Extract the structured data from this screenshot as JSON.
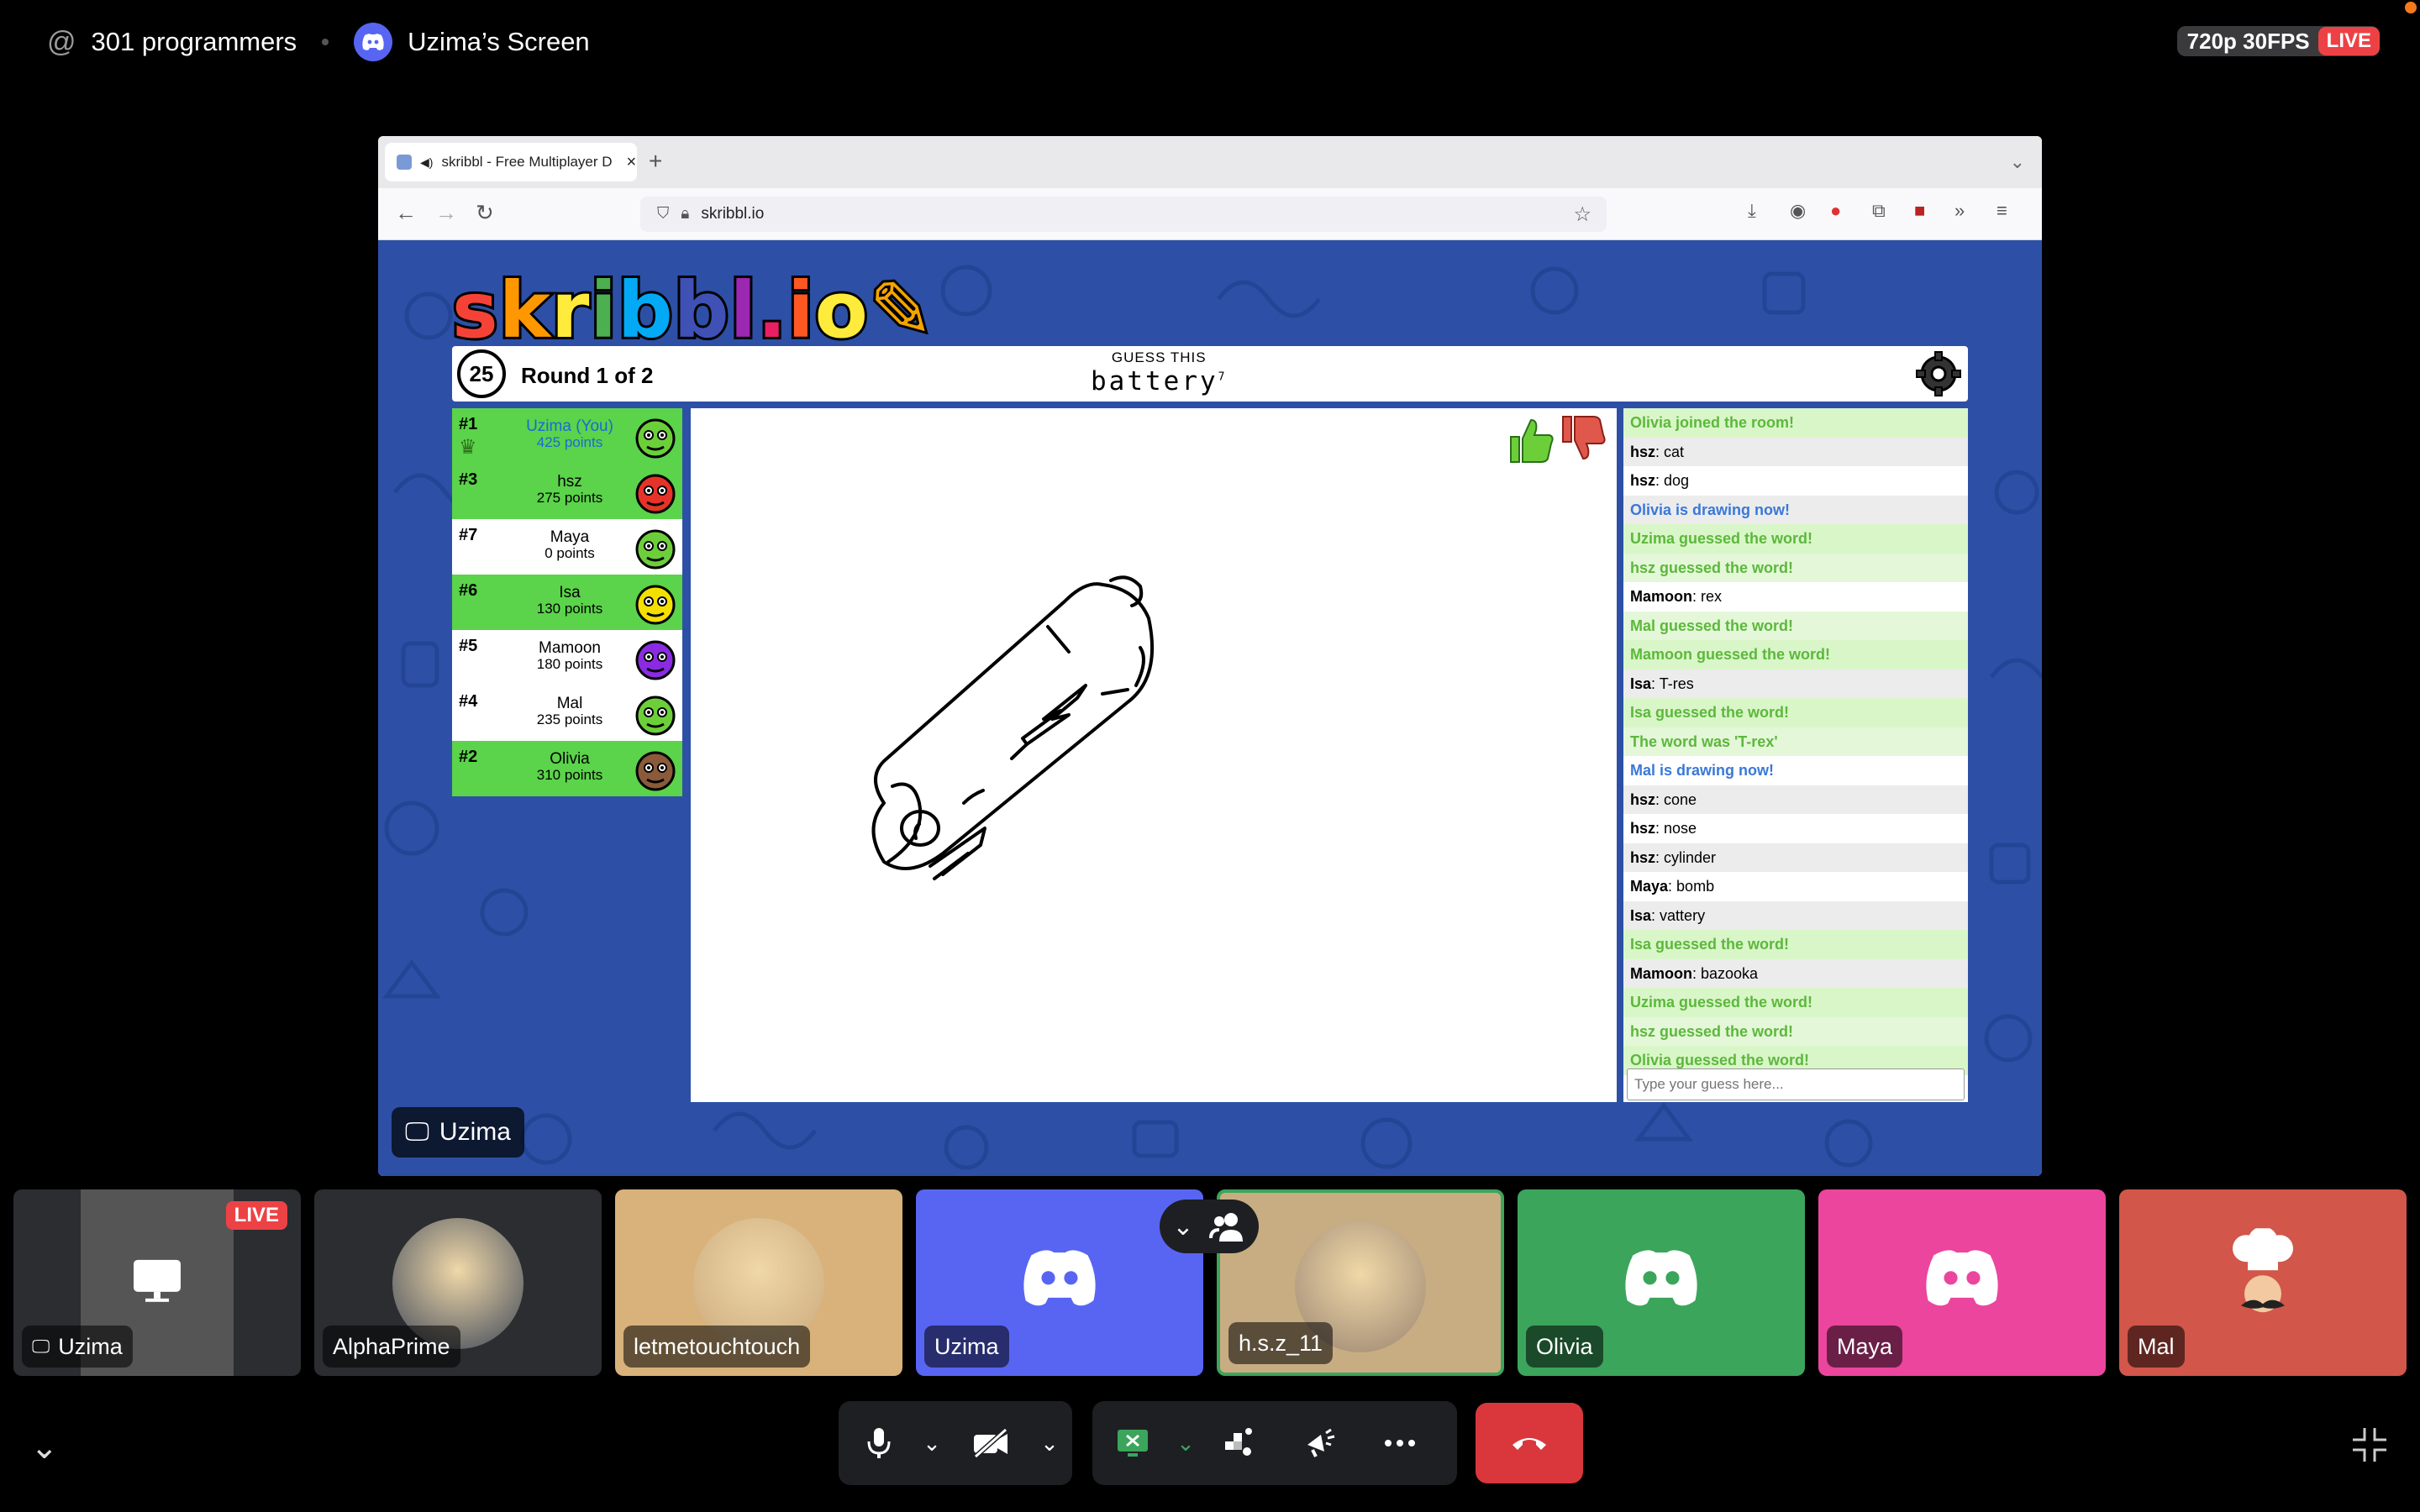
{
  "header": {
    "channel_icon": "at-sign-icon",
    "channel_name": "301 programmers",
    "stream_title": "Uzima’s Screen",
    "quality": "720p 30FPS",
    "live_badge": "LIVE"
  },
  "browser": {
    "tab_title": "skribbl - Free Multiplayer D",
    "url": "skribbl.io"
  },
  "game": {
    "logo": "skribbl.io",
    "timer": "25",
    "round": "Round 1 of 2",
    "guess_label": "GUESS THIS",
    "word": "battery",
    "word_length": "7",
    "players": [
      {
        "rank": "#1",
        "name": "Uzima (You)",
        "points": "425 points",
        "color": "#5bd34a",
        "avatar": "#6ccf3a"
      },
      {
        "rank": "#3",
        "name": "hsz",
        "points": "275 points",
        "color": "#5bd34a",
        "avatar": "#e6332a"
      },
      {
        "rank": "#7",
        "name": "Maya",
        "points": "0 points",
        "color": "#ffffff",
        "avatar": "#6ccf3a"
      },
      {
        "rank": "#6",
        "name": "Isa",
        "points": "130 points",
        "color": "#5bd34a",
        "avatar": "#f4e000"
      },
      {
        "rank": "#5",
        "name": "Mamoon",
        "points": "180 points",
        "color": "#ffffff",
        "avatar": "#8a2be2"
      },
      {
        "rank": "#4",
        "name": "Mal",
        "points": "235 points",
        "color": "#ffffff",
        "avatar": "#6ccf3a"
      },
      {
        "rank": "#2",
        "name": "Olivia",
        "points": "310 points",
        "color": "#5bd34a",
        "avatar": "#8a5a3a"
      }
    ],
    "chat": [
      {
        "user": "",
        "text": "Olivia joined the room!",
        "kind": "green"
      },
      {
        "user": "hsz",
        "text": "cat",
        "kind": "normal"
      },
      {
        "user": "hsz",
        "text": "dog",
        "kind": "normal"
      },
      {
        "user": "",
        "text": "Olivia is drawing now!",
        "kind": "blue"
      },
      {
        "user": "",
        "text": "Uzima guessed the word!",
        "kind": "green"
      },
      {
        "user": "",
        "text": "hsz guessed the word!",
        "kind": "green"
      },
      {
        "user": "Mamoon",
        "text": "rex",
        "kind": "normal"
      },
      {
        "user": "",
        "text": "Mal guessed the word!",
        "kind": "green"
      },
      {
        "user": "",
        "text": "Mamoon guessed the word!",
        "kind": "green"
      },
      {
        "user": "Isa",
        "text": "T-res",
        "kind": "normal"
      },
      {
        "user": "",
        "text": "Isa guessed the word!",
        "kind": "green"
      },
      {
        "user": "",
        "text": "The word was 'T-rex'",
        "kind": "green"
      },
      {
        "user": "",
        "text": "Mal is drawing now!",
        "kind": "blue"
      },
      {
        "user": "hsz",
        "text": "cone",
        "kind": "normal"
      },
      {
        "user": "hsz",
        "text": "nose",
        "kind": "normal"
      },
      {
        "user": "hsz",
        "text": "cylinder",
        "kind": "normal"
      },
      {
        "user": "Maya",
        "text": "bomb",
        "kind": "normal"
      },
      {
        "user": "Isa",
        "text": "vattery",
        "kind": "normal"
      },
      {
        "user": "",
        "text": "Isa guessed the word!",
        "kind": "green"
      },
      {
        "user": "Mamoon",
        "text": "bazooka",
        "kind": "normal"
      },
      {
        "user": "",
        "text": "Uzima guessed the word!",
        "kind": "green"
      },
      {
        "user": "",
        "text": "hsz guessed the word!",
        "kind": "green"
      },
      {
        "user": "",
        "text": "Olivia guessed the word!",
        "kind": "green"
      }
    ],
    "guess_placeholder": "Type your guess here..."
  },
  "presenter_label": "Uzima",
  "participants": [
    {
      "name": "Uzima",
      "bg": "#2b2d31",
      "type": "stream",
      "live": "LIVE"
    },
    {
      "name": "AlphaPrime",
      "bg": "#2b2d31",
      "type": "avatar",
      "avatar": "#3c4658"
    },
    {
      "name": "letmetouchtouch",
      "bg": "#d8b27a",
      "type": "avatar",
      "avatar": "#c9a77a"
    },
    {
      "name": "Uzima",
      "bg": "#5865f2",
      "type": "discord"
    },
    {
      "name": "h.s.z_11",
      "bg": "#c8ad83",
      "type": "avatar",
      "avatar": "#9a8470"
    },
    {
      "name": "Olivia",
      "bg": "#3ba55c",
      "type": "discord"
    },
    {
      "name": "Maya",
      "bg": "#eb459e",
      "type": "discord"
    },
    {
      "name": "Mal",
      "bg": "#d2564a",
      "type": "chef"
    }
  ],
  "icons": {
    "mic": "microphone-icon",
    "camera": "camera-off-icon",
    "share": "screen-share-icon",
    "activities": "activities-icon",
    "soundboard": "soundboard-icon",
    "more": "more-icon",
    "leave": "hang-up-icon"
  }
}
